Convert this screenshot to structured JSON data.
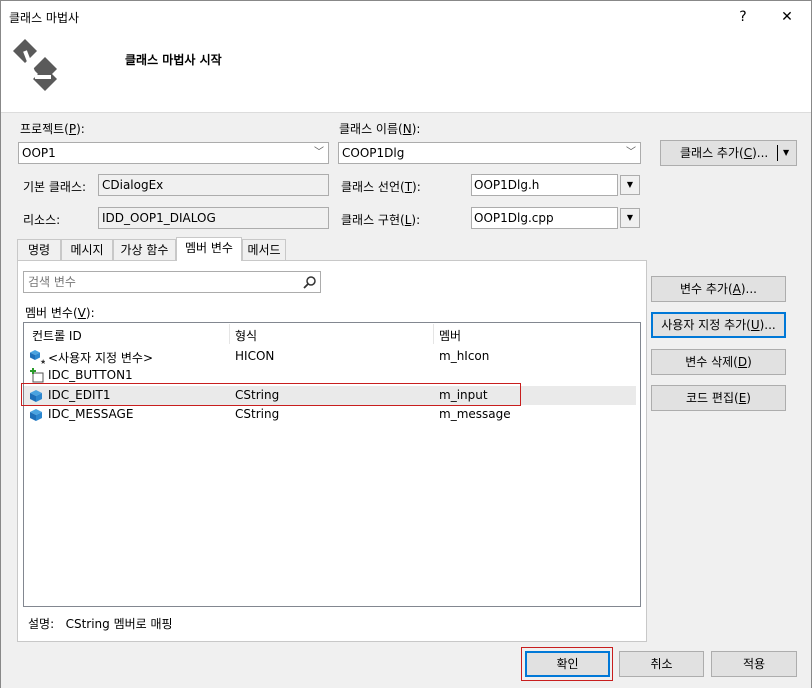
{
  "window": {
    "title": "클래스 마법사",
    "help_btn": "?",
    "close_btn": "✕"
  },
  "header": {
    "title": "클래스 마법사 시작"
  },
  "project": {
    "label": "프로젝트(P):",
    "value": "OOP1"
  },
  "class_name": {
    "label": "클래스 이름(N):",
    "value": "COOP1Dlg"
  },
  "add_class_btn": "클래스 추가(C)...",
  "base_class": {
    "label": "기본 클래스:",
    "value": "CDialogEx"
  },
  "class_decl": {
    "label": "클래스 선언(T):",
    "value": "OOP1Dlg.h"
  },
  "resource": {
    "label": "리소스:",
    "value": "IDD_OOP1_DIALOG"
  },
  "class_impl": {
    "label": "클래스 구현(L):",
    "value": "OOP1Dlg.cpp"
  },
  "tabs": [
    {
      "label": "명령"
    },
    {
      "label": "메시지"
    },
    {
      "label": "가상 함수"
    },
    {
      "label": "멤버 변수"
    },
    {
      "label": "메서드"
    }
  ],
  "search": {
    "placeholder": "검색 변수"
  },
  "member_vars_label": "멤버 변수(V):",
  "columns": [
    "컨트롤 ID",
    "형식",
    "멤버"
  ],
  "rows": [
    {
      "id": "<사용자 지정 변수>",
      "type": "HICON",
      "member": "m_hIcon"
    },
    {
      "id": "IDC_BUTTON1",
      "type": "",
      "member": ""
    },
    {
      "id": "IDC_EDIT1",
      "type": "CString",
      "member": "m_input"
    },
    {
      "id": "IDC_MESSAGE",
      "type": "CString",
      "member": "m_message"
    }
  ],
  "side_buttons": {
    "add_var": "변수 추가(A)...",
    "add_custom": "사용자 지정 추가(U)...",
    "delete_var": "변수 삭제(D)",
    "edit_code": "코드 편집(E)"
  },
  "description": "설명:   CString 멤버로 매핑",
  "footer": {
    "ok": "확인",
    "cancel": "취소",
    "apply": "적용"
  },
  "colors": {
    "highlight_red": "#c81e1e",
    "focus_blue": "#0078d7"
  }
}
